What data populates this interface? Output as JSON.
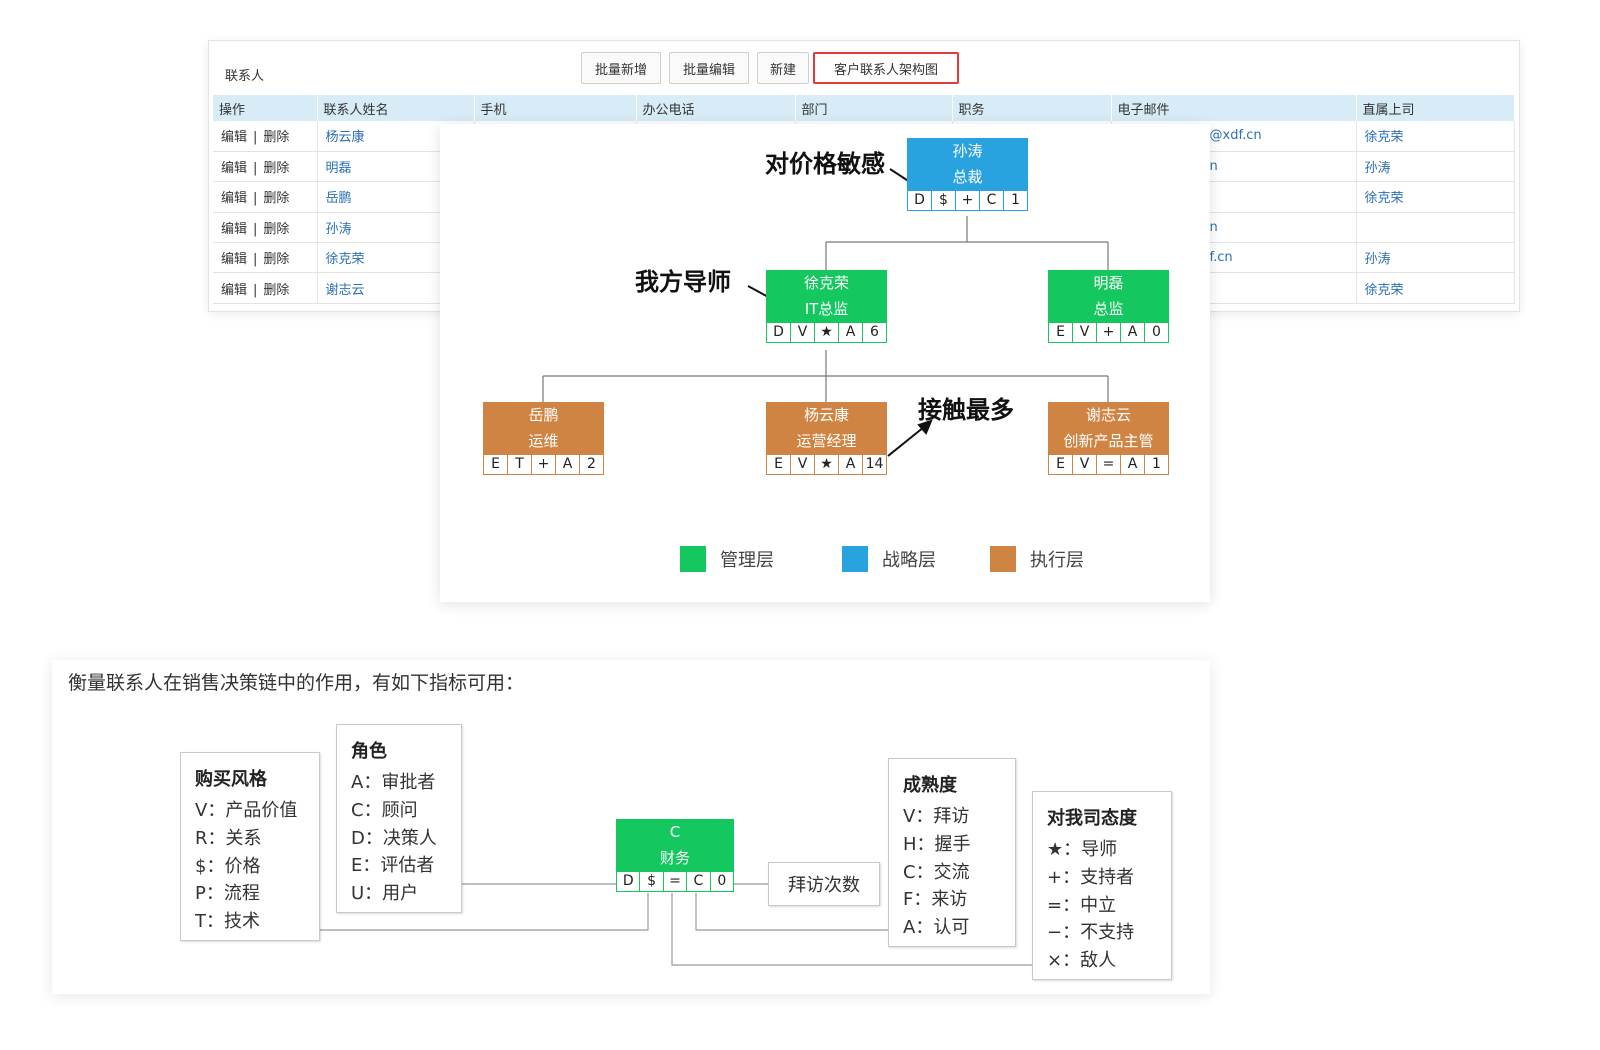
{
  "panel": {
    "title": "联系人",
    "buttons": [
      "批量新增",
      "批量编辑",
      "新建",
      "客户联系人架构图"
    ],
    "columns": [
      "操作",
      "联系人姓名",
      "手机",
      "办公电话",
      "部门",
      "职务",
      "电子邮件",
      "直属上司"
    ],
    "op_edit": "编辑",
    "op_sep": "|",
    "op_delete": "删除",
    "rows": [
      {
        "name": "杨云康",
        "email": "@xdf.cn",
        "boss": "徐克荣"
      },
      {
        "name": "明磊",
        "email": "n",
        "boss": "孙涛"
      },
      {
        "name": "岳鹏",
        "email": "",
        "boss": "徐克荣"
      },
      {
        "name": "孙涛",
        "email": "n",
        "boss": ""
      },
      {
        "name": "徐克荣",
        "email": "f.cn",
        "boss": "孙涛"
      },
      {
        "name": "谢志云",
        "email": "",
        "boss": "徐克荣"
      }
    ]
  },
  "org": {
    "nodes": [
      {
        "id": "sun",
        "name": "孙涛",
        "title": "总裁",
        "layer": "blue",
        "codes": [
          "D",
          "$",
          "+",
          "C",
          "1"
        ]
      },
      {
        "id": "xu",
        "name": "徐克荣",
        "title": "IT总监",
        "layer": "green",
        "codes": [
          "D",
          "V",
          "★",
          "A",
          "6"
        ]
      },
      {
        "id": "ming",
        "name": "明磊",
        "title": "总监",
        "layer": "green",
        "codes": [
          "E",
          "V",
          "+",
          "A",
          "0"
        ]
      },
      {
        "id": "yue",
        "name": "岳鹏",
        "title": "运维",
        "layer": "orange",
        "codes": [
          "E",
          "T",
          "+",
          "A",
          "2"
        ]
      },
      {
        "id": "yang",
        "name": "杨云康",
        "title": "运营经理",
        "layer": "orange",
        "codes": [
          "E",
          "V",
          "★",
          "A",
          "14"
        ]
      },
      {
        "id": "xie",
        "name": "谢志云",
        "title": "创新产品主管",
        "layer": "orange",
        "codes": [
          "E",
          "V",
          "=",
          "A",
          "1"
        ]
      }
    ],
    "annotations": {
      "price": "对价格敏感",
      "mentor": "我方导师",
      "contact": "接触最多"
    },
    "legend": [
      {
        "label": "管理层",
        "color": "#14c75f"
      },
      {
        "label": "战略层",
        "color": "#29a3e0"
      },
      {
        "label": "执行层",
        "color": "#d08443"
      }
    ],
    "colors": {
      "blue": "#29a3e0",
      "green": "#14c75f",
      "orange": "#d08443"
    }
  },
  "metrics": {
    "title": "衡量联系人在销售决策链中的作用，有如下指标可用：",
    "buy_style": {
      "heading": "购买风格",
      "items": [
        "V：产品价值",
        "R：关系",
        "$：价格",
        "P：流程",
        "T：技术"
      ]
    },
    "role": {
      "heading": "角色",
      "items": [
        "A：审批者",
        "C：顾问",
        "D：决策人",
        "E：评估者",
        "U：用户"
      ]
    },
    "maturity": {
      "heading": "成熟度",
      "items": [
        "V：拜访",
        "H：握手",
        "C：交流",
        "F：来访",
        "A：认可"
      ]
    },
    "attitude": {
      "heading": "对我司态度",
      "items": [
        "★：导师",
        "+：支持者",
        "=：中立",
        "−：不支持",
        "×：敌人"
      ]
    },
    "center": {
      "name": "C",
      "title": "财务",
      "codes": [
        "D",
        "$",
        "=",
        "C",
        "0"
      ]
    },
    "visits": "拜访次数"
  }
}
